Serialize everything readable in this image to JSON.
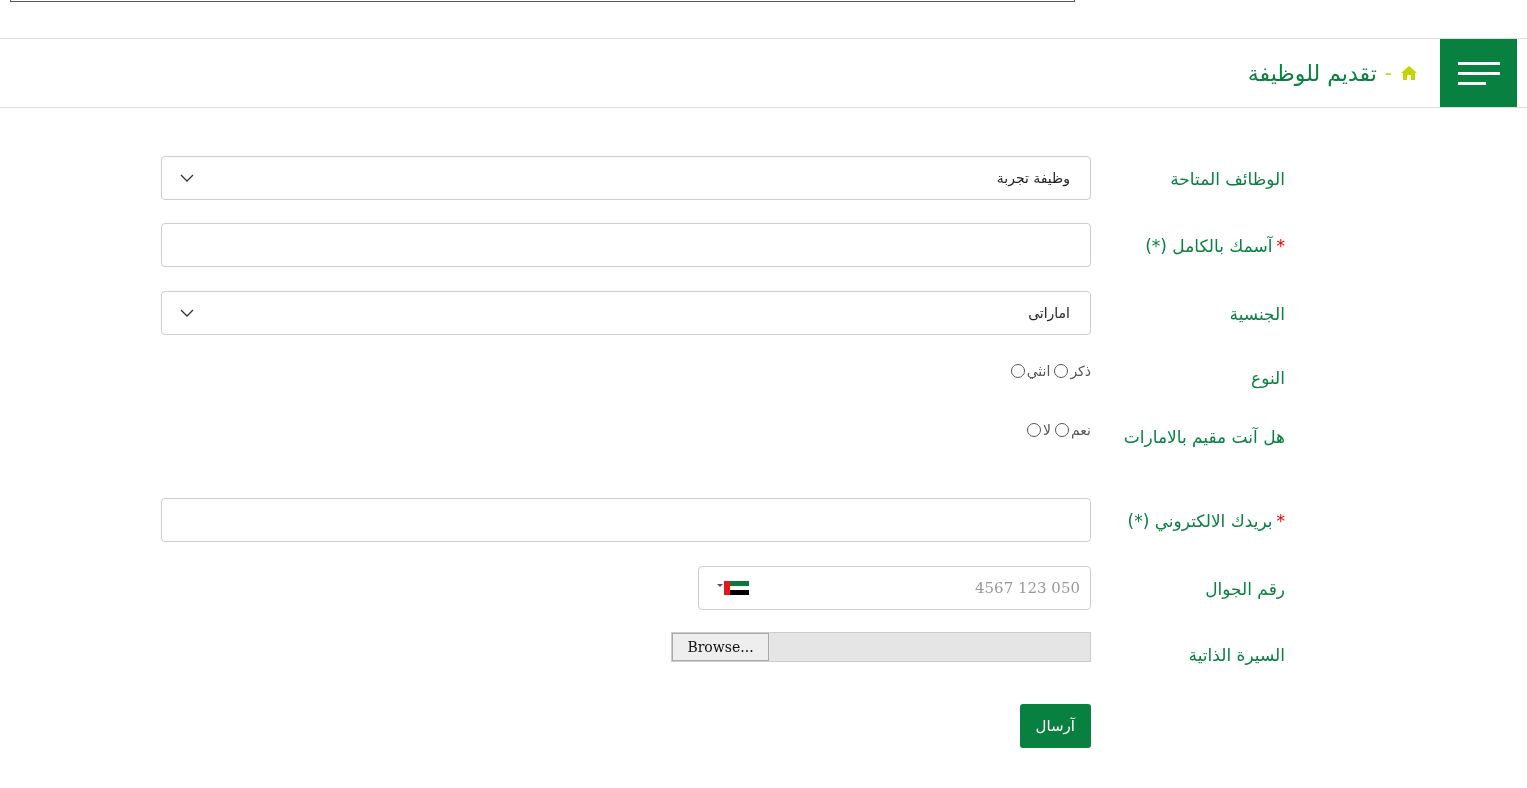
{
  "header": {
    "title": "تقديم للوظيفة",
    "separator": "-"
  },
  "fields": [
    {
      "kind": "select",
      "label": "الوظائف المتاحة",
      "value": "وظيفة تجربة"
    },
    {
      "kind": "text",
      "label": "آسمك بالكامل (*)",
      "mark": "*"
    },
    {
      "kind": "select",
      "label": "الجنسية",
      "value": "اماراتى"
    },
    {
      "kind": "radio",
      "label": "النوع",
      "options": [
        {
          "label": "ذكر",
          "selected": false
        },
        {
          "label": "انثي",
          "selected": false
        }
      ]
    },
    {
      "kind": "radio",
      "label": "هل آنت مقيم بالامارات",
      "options": [
        {
          "label": "نعم",
          "selected": false
        },
        {
          "label": "لا",
          "selected": false
        }
      ]
    },
    {
      "kind": "text",
      "label": "بريدك الالكتروني (*)",
      "mark": "*"
    },
    {
      "kind": "phone",
      "label": "رقم الجوال",
      "placeholder": "4567 123 050"
    },
    {
      "kind": "file",
      "label": "السيرة الذاتية",
      "button": "Browse..."
    }
  ],
  "submit": "آرسال"
}
